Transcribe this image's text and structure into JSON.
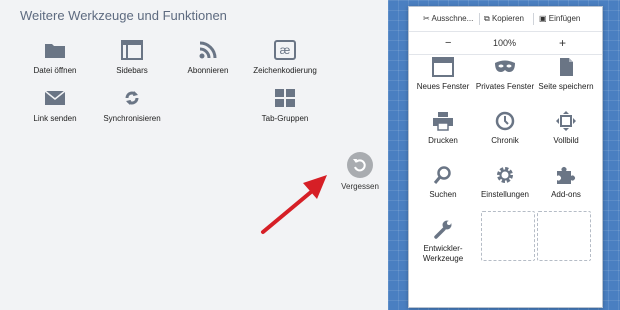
{
  "left": {
    "title": "Weitere Werkzeuge und Funktionen",
    "tools": [
      {
        "label": "Datei öffnen",
        "icon": "folder-icon"
      },
      {
        "label": "Sidebars",
        "icon": "sidebar-icon"
      },
      {
        "label": "Abonnieren",
        "icon": "rss-icon"
      },
      {
        "label": "Zeichenkodierung",
        "icon": "character-encoding-icon"
      },
      {
        "label": "Link senden",
        "icon": "mail-icon"
      },
      {
        "label": "Synchronisieren",
        "icon": "sync-icon"
      },
      {
        "label": "Tab-Gruppen",
        "icon": "tab-groups-icon"
      }
    ],
    "forget_label": "Vergessen",
    "encoding_glyph": "æ"
  },
  "panel": {
    "edit": {
      "cut": "Ausschne...",
      "copy": "Kopieren",
      "paste": "Einfügen"
    },
    "zoom": {
      "minus": "−",
      "value": "100%",
      "plus": "+"
    },
    "items": [
      {
        "label": "Neues Fenster",
        "icon": "new-window-icon"
      },
      {
        "label": "Privates Fenster",
        "icon": "private-mask-icon"
      },
      {
        "label": "Seite speichern",
        "icon": "save-page-icon"
      },
      {
        "label": "Drucken",
        "icon": "printer-icon"
      },
      {
        "label": "Chronik",
        "icon": "clock-icon"
      },
      {
        "label": "Vollbild",
        "icon": "fullscreen-icon"
      },
      {
        "label": "Suchen",
        "icon": "search-icon"
      },
      {
        "label": "Einstellungen",
        "icon": "gear-icon"
      },
      {
        "label": "Add-ons",
        "icon": "puzzle-icon"
      },
      {
        "label": "Entwickler-Werkzeuge",
        "icon": "wrench-icon"
      }
    ]
  },
  "colors": {
    "background": "#f2f3f5",
    "blue": "#4a7fc1",
    "icon": "#6a7585",
    "arrow": "#d61f26",
    "title": "#5e6b80"
  }
}
